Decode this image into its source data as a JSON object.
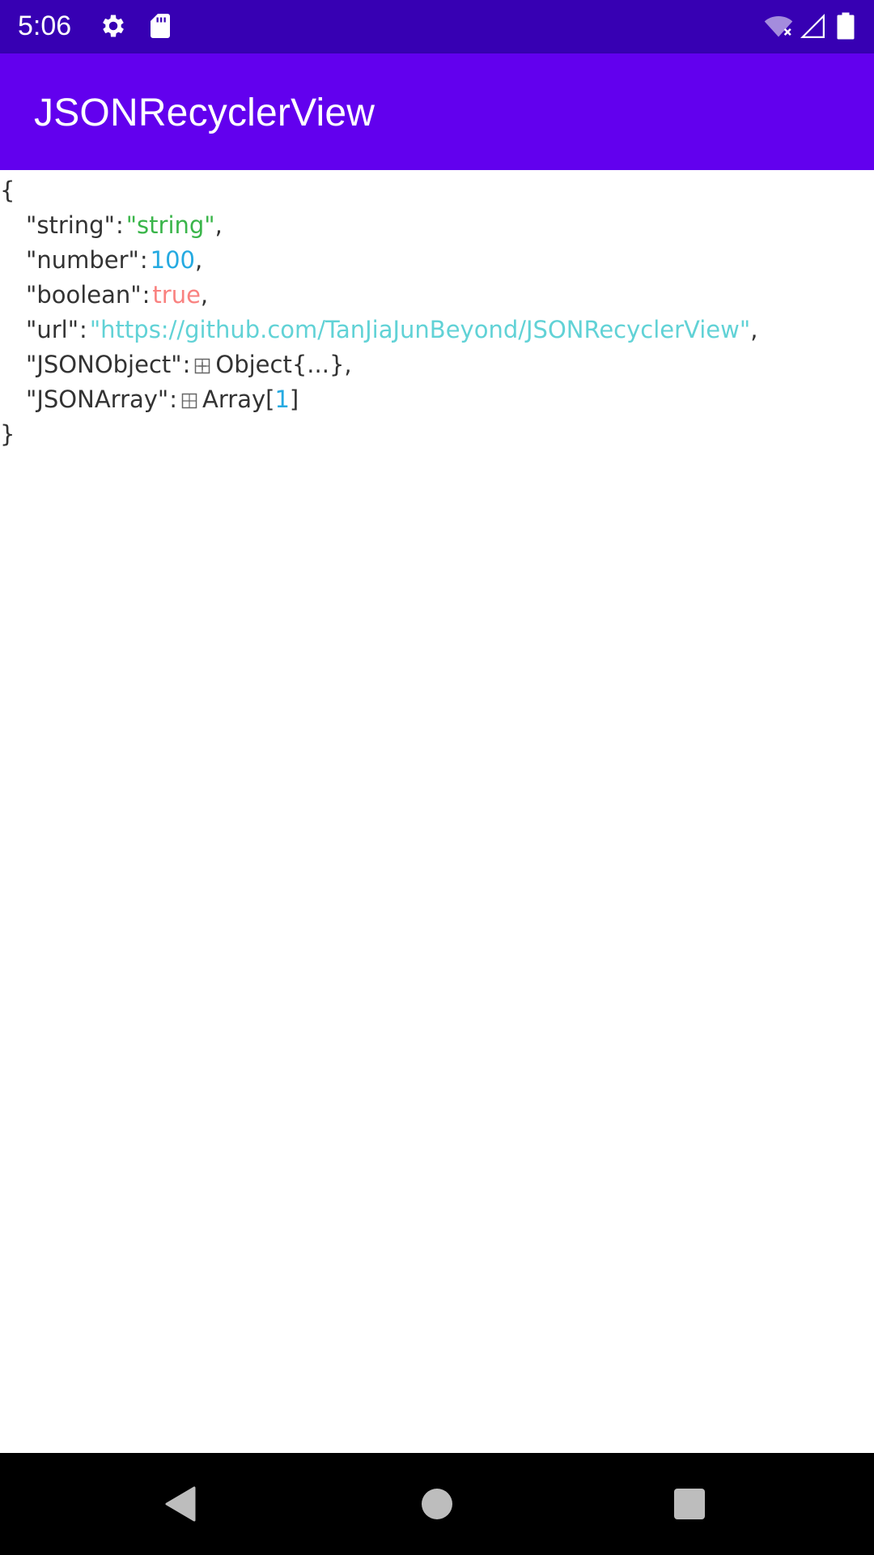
{
  "status_bar": {
    "time": "5:06",
    "icons": [
      "gear-icon",
      "sd-card-icon",
      "wifi-off-icon",
      "cell-signal-icon",
      "battery-icon"
    ]
  },
  "app_bar": {
    "title": "JSONRecyclerView"
  },
  "json": {
    "open_brace": "{",
    "close_brace": "}",
    "entries": [
      {
        "key": "\"string\"",
        "colon": ":",
        "value": "\"string\"",
        "type": "string",
        "trail": ","
      },
      {
        "key": "\"number\"",
        "colon": ":",
        "value": "100",
        "type": "number",
        "trail": ","
      },
      {
        "key": "\"boolean\"",
        "colon": ":",
        "value": "true",
        "type": "boolean",
        "trail": ","
      },
      {
        "key": "\"url\"",
        "colon": ":",
        "value": "\"https://github.com/TanJiaJunBeyond/JSONRecyclerView\"",
        "type": "url",
        "trail": ","
      },
      {
        "key": "\"JSONObject\"",
        "colon": ":",
        "collapsed_label": "Object{...}",
        "type": "object",
        "trail": ","
      },
      {
        "key": "\"JSONArray\"",
        "colon": ":",
        "collapsed_label": "Array[",
        "count": "1",
        "close": "]",
        "type": "array",
        "trail": ""
      }
    ]
  },
  "colors": {
    "status_bar": "#3700b3",
    "app_bar": "#6200ee",
    "string": "#3ab54a",
    "number": "#25aae1",
    "boolean": "#f98280",
    "url": "#61d2d6",
    "text": "#333333"
  },
  "nav_bar": {
    "buttons": [
      "back-icon",
      "home-icon",
      "recents-icon"
    ]
  }
}
